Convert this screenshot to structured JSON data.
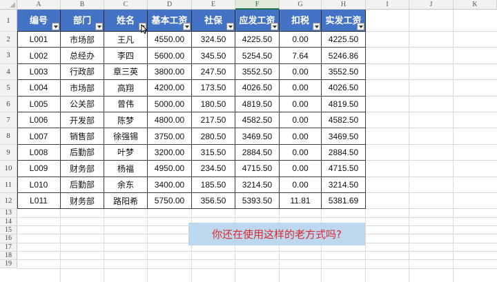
{
  "sheet": {
    "column_letters": [
      "A",
      "B",
      "C",
      "D",
      "E",
      "F",
      "G",
      "H",
      "I",
      "J",
      "K"
    ],
    "selected_column": "F",
    "row_numbers": [
      "1",
      "2",
      "3",
      "4",
      "5",
      "6",
      "7",
      "8",
      "9",
      "10",
      "11",
      "12",
      "13",
      "14",
      "15",
      "16",
      "17",
      "18",
      "19"
    ],
    "table": {
      "headers": [
        "编号",
        "部门",
        "姓名",
        "基本工资",
        "社保",
        "应发工资",
        "扣税",
        "实发工资"
      ],
      "rows": [
        [
          "L001",
          "市场部",
          "王凡",
          "4550.00",
          "324.50",
          "4225.50",
          "0.00",
          "4225.50"
        ],
        [
          "L002",
          "总经办",
          "李四",
          "5600.00",
          "345.50",
          "5254.50",
          "7.64",
          "5246.86"
        ],
        [
          "L003",
          "行政部",
          "章三英",
          "3800.00",
          "247.50",
          "3552.50",
          "0.00",
          "3552.50"
        ],
        [
          "L004",
          "市场部",
          "高翔",
          "4200.00",
          "173.50",
          "4026.50",
          "0.00",
          "4026.50"
        ],
        [
          "L005",
          "公关部",
          "曾伟",
          "5000.00",
          "180.50",
          "4819.50",
          "0.00",
          "4819.50"
        ],
        [
          "L006",
          "开发部",
          "陈梦",
          "4800.00",
          "217.50",
          "4582.50",
          "0.00",
          "4582.50"
        ],
        [
          "L007",
          "销售部",
          "徐强锡",
          "3750.00",
          "280.50",
          "3469.50",
          "0.00",
          "3469.50"
        ],
        [
          "L008",
          "后勤部",
          "叶梦",
          "3200.00",
          "315.50",
          "2884.50",
          "0.00",
          "2884.50"
        ],
        [
          "L009",
          "财务部",
          "杨福",
          "4950.00",
          "234.50",
          "4715.50",
          "0.00",
          "4715.50"
        ],
        [
          "L010",
          "后勤部",
          "余东",
          "3400.00",
          "185.50",
          "3214.50",
          "0.00",
          "3214.50"
        ],
        [
          "L011",
          "财务部",
          "路阳希",
          "5750.00",
          "356.50",
          "5393.50",
          "11.81",
          "5381.69"
        ]
      ]
    },
    "callout_text": "你还在使用这样的老方式吗?",
    "colors": {
      "header_fill": "#4472c4",
      "header_text": "#ffffff",
      "callout_fill": "#bdd7ee",
      "callout_text": "#e0242c",
      "selected_column_accent": "#217346"
    },
    "icons": [
      "filter-dropdown-icon",
      "mouse-cursor-icon"
    ]
  }
}
